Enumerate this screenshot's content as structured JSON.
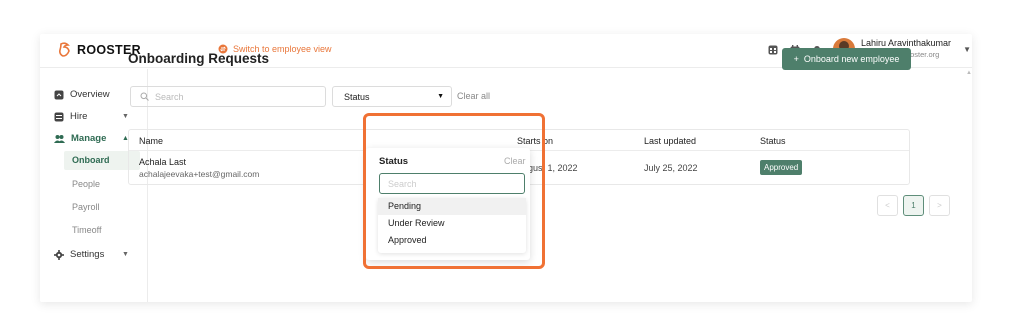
{
  "brand": {
    "name": "ROOSTER",
    "color": "#e9773b",
    "accent": "#4e7f6b"
  },
  "topbar": {
    "switch_label": "Switch to employee view",
    "icons": [
      "calendar-grid-icon",
      "calendar-icon",
      "bell-icon"
    ],
    "user": {
      "name": "Lahiru Aravinthakumar",
      "email": "lahiru+test@rooster.org"
    }
  },
  "sidebar": {
    "items": [
      {
        "label": "Overview",
        "icon": "overview-icon"
      },
      {
        "label": "Hire",
        "icon": "hire-icon"
      },
      {
        "label": "Manage",
        "icon": "manage-icon"
      },
      {
        "label": "Settings",
        "icon": "gear-icon"
      }
    ],
    "sub_items": [
      "Onboard",
      "People",
      "Payroll",
      "Timeoff"
    ]
  },
  "main": {
    "title": "Onboarding Requests",
    "onboard_button": "Onboard new employee",
    "search_placeholder": "Search",
    "status_filter": "Status",
    "clear_all": "Clear all",
    "table": {
      "headers": [
        "Name",
        "Starts on",
        "Last updated",
        "Status"
      ],
      "rows": [
        {
          "name": "Achala Last",
          "email": "achalajeevaka+test@gmail.com",
          "starts_on": "August 1, 2022",
          "last_updated": "July 25, 2022",
          "status": "Approved"
        }
      ]
    },
    "pagination": {
      "current": "1",
      "prev": "<",
      "next": ">"
    }
  },
  "status_dropdown": {
    "title": "Status",
    "clear": "Clear",
    "search_placeholder": "Search",
    "options": [
      "Pending",
      "Under Review",
      "Approved"
    ],
    "hovered": "Pending"
  }
}
